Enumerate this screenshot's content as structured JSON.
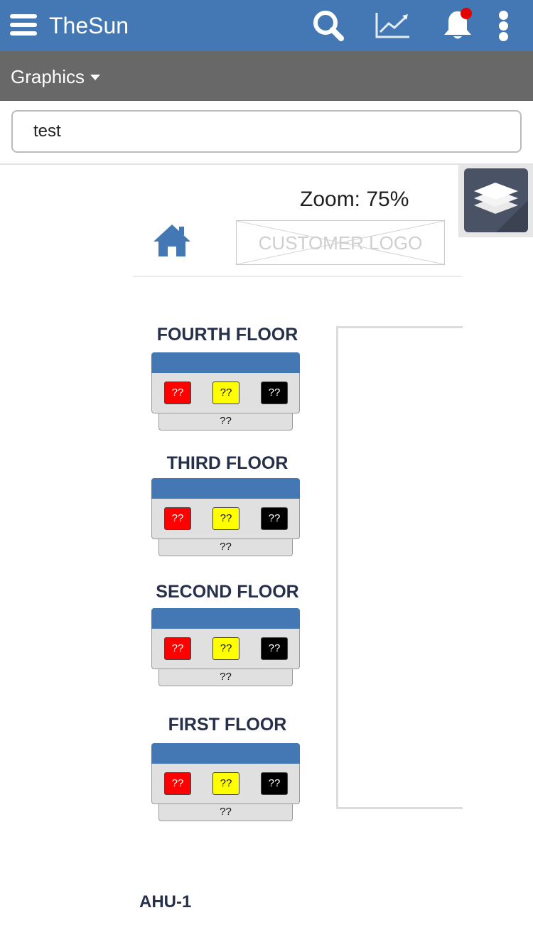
{
  "app": {
    "title": "TheSun"
  },
  "icons": {
    "menu": "hamburger-menu-icon",
    "search": "search-icon",
    "trend": "line-chart-icon",
    "notifications": "bell-icon",
    "more": "kebab-more-icon",
    "layers": "layers-icon",
    "home": "home-icon"
  },
  "colors": {
    "primary": "#4478b4",
    "subbar": "#686868",
    "alarm_red": "#ff0000",
    "warning_yellow": "#ffff00",
    "status_black": "#000000",
    "notification_dot": "#e30000"
  },
  "subbar": {
    "menu_label": "Graphics"
  },
  "search": {
    "value": "test"
  },
  "zoom": {
    "label": "Zoom: 75%"
  },
  "logo": {
    "placeholder_text": "CUSTOMER LOGO"
  },
  "floors": [
    {
      "title": "FOURTH FLOOR",
      "red": "??",
      "yellow": "??",
      "black": "??",
      "footer": "??"
    },
    {
      "title": "THIRD FLOOR",
      "red": "??",
      "yellow": "??",
      "black": "??",
      "footer": "??"
    },
    {
      "title": "SECOND FLOOR",
      "red": "??",
      "yellow": "??",
      "black": "??",
      "footer": "??"
    },
    {
      "title": "FIRST FLOOR",
      "red": "??",
      "yellow": "??",
      "black": "??",
      "footer": "??"
    }
  ],
  "equipment": {
    "label": "AHU-1"
  }
}
